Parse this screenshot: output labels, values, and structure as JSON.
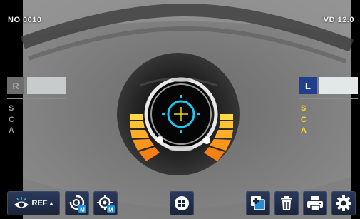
{
  "header": {
    "number": "NO 0010",
    "vertex_distance": "VD 12.0"
  },
  "right_eye": {
    "letter": "R",
    "labels": [
      "S",
      "C",
      "A"
    ]
  },
  "left_eye": {
    "letter": "L",
    "labels": [
      "S",
      "C",
      "A"
    ]
  },
  "toolbar": {
    "ref_label": "REF"
  },
  "colors": {
    "reticle": "#1ec8f0",
    "crosshair": "#f2d21a",
    "left_selected": "#203f8c",
    "sca_active": "#f2dd2a",
    "bars": [
      "#ffd84a",
      "#ffc234",
      "#ffad27",
      "#ff961c",
      "#f77f14"
    ]
  }
}
